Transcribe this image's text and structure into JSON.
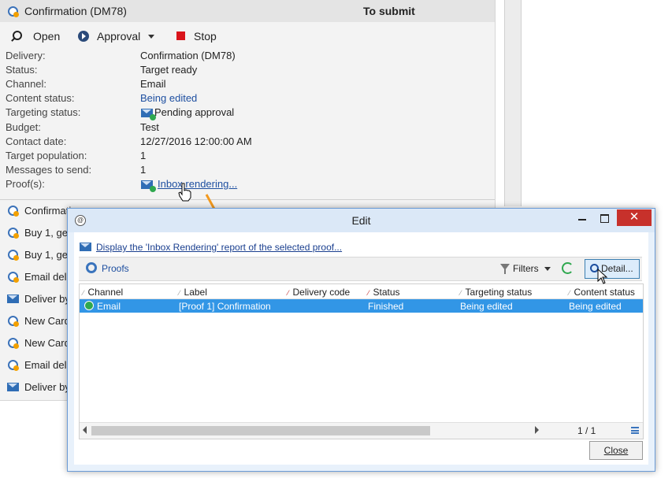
{
  "background_panel": {
    "header": {
      "title": "Confirmation (DM78)",
      "status": "To submit"
    },
    "toolbar": {
      "open_label": "Open",
      "approval_label": "Approval",
      "stop_label": "Stop"
    },
    "details": [
      {
        "label": "Delivery:",
        "value": "Confirmation (DM78)",
        "style": "plain"
      },
      {
        "label": "Status:",
        "value": "Target ready",
        "style": "plain"
      },
      {
        "label": "Channel:",
        "value": "Email",
        "style": "plain"
      },
      {
        "label": "Content status:",
        "value": "Being edited",
        "style": "blue"
      },
      {
        "label": "Targeting status:",
        "value": "Pending approval",
        "style": "icon"
      },
      {
        "label": "Budget:",
        "value": "Test",
        "style": "plain"
      },
      {
        "label": "Contact date:",
        "value": "12/27/2016 12:00:00 AM",
        "style": "plain"
      },
      {
        "label": "Target population:",
        "value": "1",
        "style": "plain"
      },
      {
        "label": "Messages to send:",
        "value": "1",
        "style": "plain"
      },
      {
        "label": "Proof(s):",
        "value": "Inbox rendering...",
        "style": "link"
      }
    ],
    "list_items": [
      {
        "text": "Confirmatio",
        "icon": "delivery-icon"
      },
      {
        "text": "Buy 1, ge",
        "icon": "delivery-icon"
      },
      {
        "text": "Buy 1, ge",
        "icon": "delivery-icon"
      },
      {
        "text": "Email deli",
        "icon": "delivery-icon"
      },
      {
        "text": "Deliver by",
        "icon": "mail-icon"
      },
      {
        "text": "New Card",
        "icon": "delivery-icon"
      },
      {
        "text": "New Card",
        "icon": "delivery-icon"
      },
      {
        "text": "Email deli",
        "icon": "delivery-icon"
      },
      {
        "text": "Deliver by",
        "icon": "mail-icon"
      }
    ]
  },
  "dialog": {
    "title": "Edit",
    "inbox_link": "Display the 'Inbox Rendering' report of the selected proof...",
    "proofs_label": "Proofs",
    "filters_label": "Filters",
    "detail_label": "Detail...",
    "columns": [
      "Channel",
      "Label",
      "Delivery code",
      "Status",
      "Targeting status",
      "Content status"
    ],
    "rows": [
      {
        "channel": "Email",
        "label": "[Proof 1] Confirmation",
        "delivery_code": "",
        "status": "Finished",
        "targeting_status": "Being edited",
        "content_status": "Being edited"
      }
    ],
    "pager": "1 / 1",
    "close_label": "Close"
  },
  "colors": {
    "accent_orange": "#f39a1e",
    "selection_blue": "#3296e6",
    "link_blue": "#1a3f8f",
    "close_red": "#c7312b"
  }
}
